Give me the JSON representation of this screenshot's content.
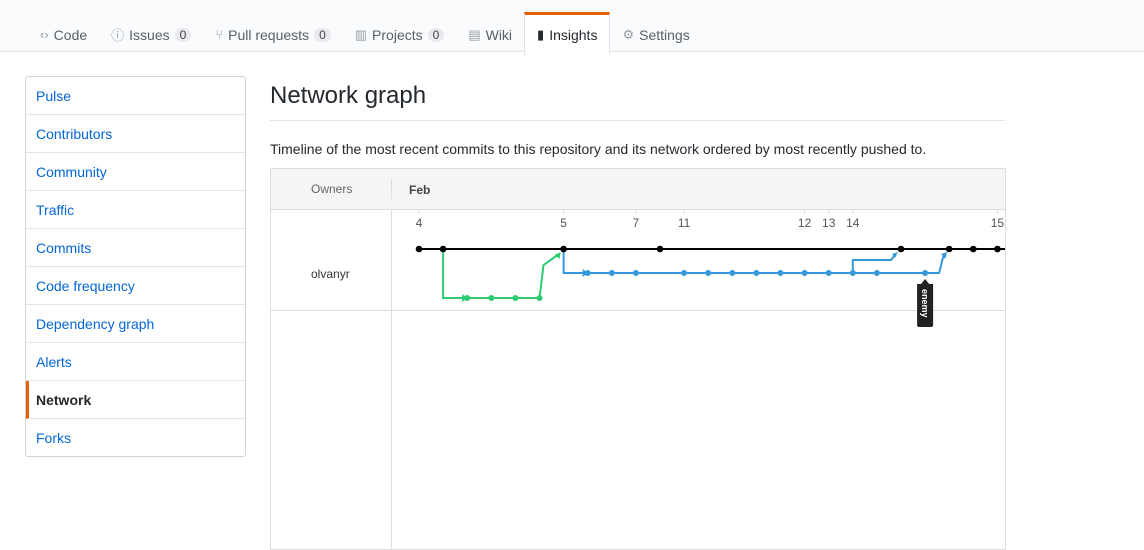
{
  "tabs": [
    {
      "label": "Code",
      "icon": "code-icon",
      "glyph": "‹›"
    },
    {
      "label": "Issues",
      "count": "0",
      "icon": "issue-icon",
      "glyph": "ⓘ"
    },
    {
      "label": "Pull requests",
      "count": "0",
      "icon": "pull-request-icon",
      "glyph": "⑂"
    },
    {
      "label": "Projects",
      "count": "0",
      "icon": "project-icon",
      "glyph": "▥"
    },
    {
      "label": "Wiki",
      "icon": "book-icon",
      "glyph": "▤"
    },
    {
      "label": "Insights",
      "icon": "graph-icon",
      "glyph": "▮",
      "selected": true
    },
    {
      "label": "Settings",
      "icon": "gear-icon",
      "glyph": "⚙"
    }
  ],
  "sidebar": [
    "Pulse",
    "Contributors",
    "Community",
    "Traffic",
    "Commits",
    "Code frequency",
    "Dependency graph",
    "Alerts",
    "Network",
    "Forks"
  ],
  "sidebar_selected": "Network",
  "title": "Network graph",
  "description": "Timeline of the most recent commits to this repository and its network ordered by most recently pushed to.",
  "network": {
    "owners_label": "Owners",
    "month": "Feb",
    "owner": "olvanyr",
    "dates": [
      {
        "label": "4",
        "col": 0
      },
      {
        "label": "5",
        "col": 6
      },
      {
        "label": "7",
        "col": 9
      },
      {
        "label": "11",
        "col": 11
      },
      {
        "label": "12",
        "col": 16
      },
      {
        "label": "13",
        "col": 17
      },
      {
        "label": "14",
        "col": 18
      },
      {
        "label": "15",
        "col": 24
      }
    ],
    "master_commits": [
      0,
      1,
      6,
      10,
      20,
      22,
      23,
      24
    ],
    "green_commits": [
      2,
      3,
      4,
      5
    ],
    "blue_commits": [
      7,
      8,
      9,
      11,
      12,
      13,
      14,
      15,
      16,
      17,
      18,
      19,
      21
    ],
    "branch_label": "enemy",
    "branch_label_col": 21,
    "colors": {
      "master": "#000000",
      "green": "#2ecc71",
      "blue": "#3498db",
      "accent": "#e36209",
      "link": "#0366d6"
    }
  }
}
